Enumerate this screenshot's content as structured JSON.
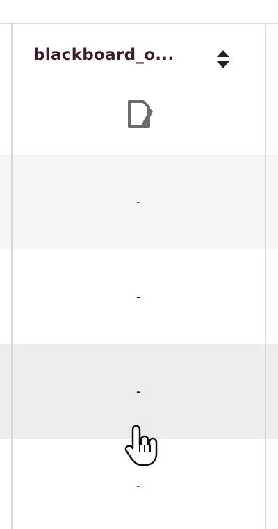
{
  "table": {
    "column": {
      "title": "blackboard_o...",
      "sort_icon": "sort-updown-icon",
      "note_icon": "note-document-icon"
    },
    "rows": [
      {
        "value": "-"
      },
      {
        "value": "-"
      },
      {
        "value": "-"
      },
      {
        "value": "-"
      }
    ]
  },
  "colors": {
    "title": "#3b1c2c",
    "row_alt_light": "#f5f5f7",
    "row_alt_dark": "#ededef",
    "border": "#d9d9d9"
  },
  "cursor": "hand-pointer-icon"
}
